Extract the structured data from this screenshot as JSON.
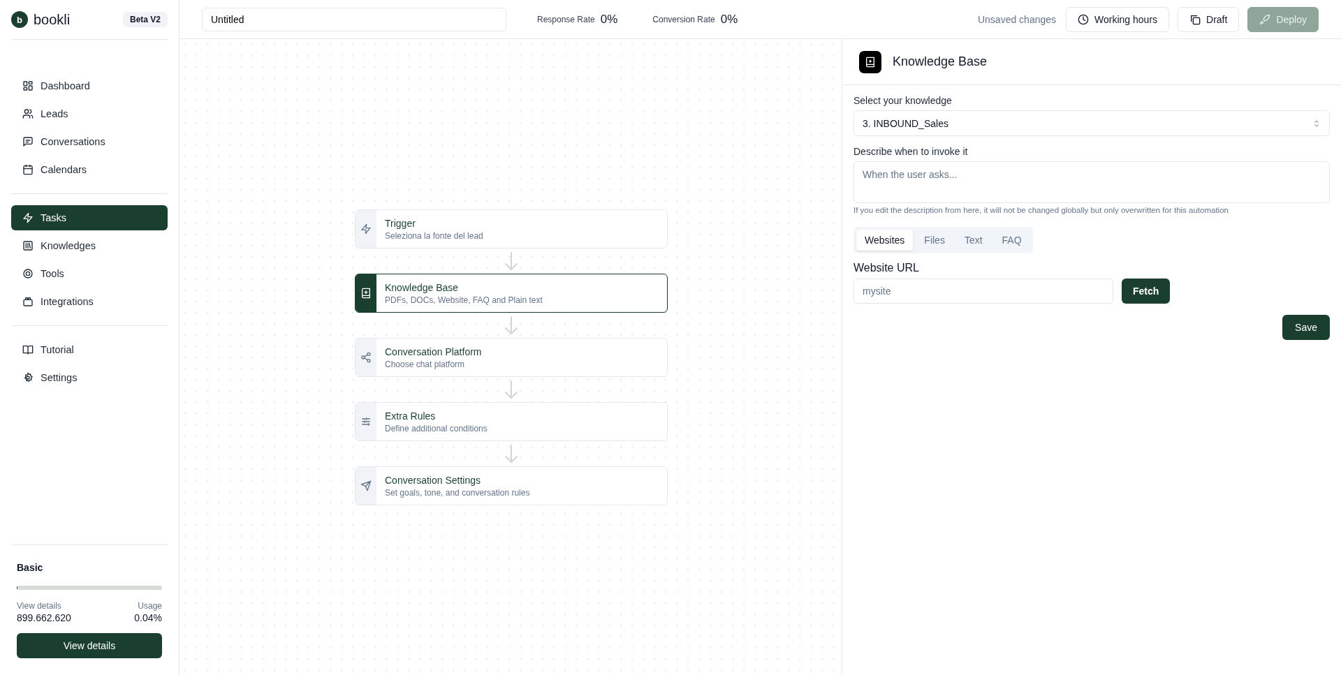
{
  "sidebar": {
    "brand": "bookli",
    "logo_letter": "b",
    "badge": "Beta V2",
    "groups": [
      [
        {
          "label": "Dashboard",
          "selected": false
        },
        {
          "label": "Leads",
          "selected": false
        },
        {
          "label": "Conversations",
          "selected": false
        },
        {
          "label": "Calendars",
          "selected": false
        }
      ],
      [
        {
          "label": "Tasks",
          "selected": true
        },
        {
          "label": "Knowledges",
          "selected": false
        },
        {
          "label": "Tools",
          "selected": false
        },
        {
          "label": "Integrations",
          "selected": false
        }
      ],
      [
        {
          "label": "Tutorial",
          "selected": false
        },
        {
          "label": "Settings",
          "selected": false
        }
      ]
    ],
    "plan": {
      "name": "Basic",
      "level": 0.0004,
      "details_label": "View details",
      "amount": "899.662.620",
      "usage_label": "Usage",
      "usage": "0.04%",
      "button": "View details"
    }
  },
  "topbar": {
    "title_value": "Untitled",
    "stats": [
      {
        "label": "Response Rate",
        "value": "0%"
      },
      {
        "label": "Conversion Rate",
        "value": "0%"
      }
    ],
    "status": "Unsaved changes",
    "buttons": [
      {
        "label": "Working hours",
        "disabled": false
      },
      {
        "label": "Draft",
        "disabled": false
      },
      {
        "label": "Deploy",
        "disabled": true
      }
    ]
  },
  "flow": {
    "nodes": [
      {
        "title": "Trigger",
        "subtitle": "Seleziona la fonte del lead",
        "selected": false
      },
      {
        "title": "Knowledge Base",
        "subtitle": "PDFs, DOCs, Website, FAQ and Plain text",
        "selected": true
      },
      {
        "title": "Conversation Platform",
        "subtitle": "Choose chat platform",
        "selected": false
      },
      {
        "title": "Extra Rules",
        "subtitle": "Define additional conditions",
        "selected": false
      },
      {
        "title": "Conversation Settings",
        "subtitle": "Set goals, tone, and conversation rules",
        "selected": false
      }
    ]
  },
  "panel": {
    "title": "Knowledge Base",
    "select_label": "Select your knowledge",
    "select_value": "3. INBOUND_Sales",
    "describe_label": "Describe when to invoke it",
    "describe_placeholder": "When the user asks...",
    "hint": "If you edit the description from here, it will not be changed globally but only overwritten for this automation",
    "tabs": [
      {
        "label": "Websites",
        "selected": true
      },
      {
        "label": "Files",
        "selected": false
      },
      {
        "label": "Text",
        "selected": false
      },
      {
        "label": "FAQ",
        "selected": false
      }
    ],
    "url_label": "Website URL",
    "url_placeholder": "mysite",
    "fetch": "Fetch",
    "save": "Save"
  }
}
